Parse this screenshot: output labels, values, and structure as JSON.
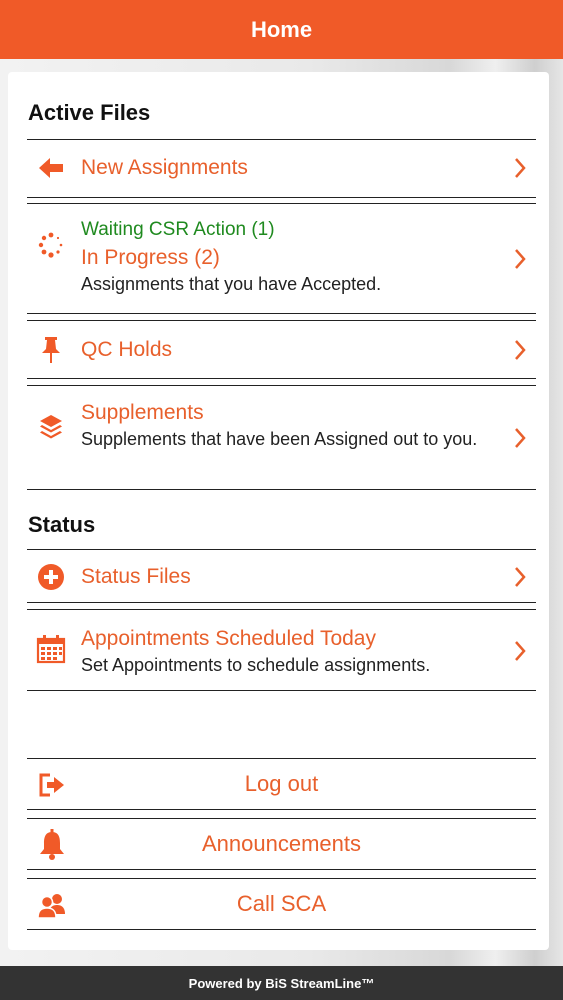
{
  "header": {
    "title": "Home"
  },
  "colors": {
    "accent": "#f05a28",
    "link": "#e8602c",
    "green": "#1f8a1f",
    "footer": "#333333"
  },
  "active_files": {
    "title": "Active Files",
    "items": [
      {
        "icon": "arrow-left-icon",
        "label": "New Assignments"
      },
      {
        "icon": "spinner-icon",
        "status": "Waiting CSR Action (1)",
        "label": "In Progress (2)",
        "description": "Assignments that you have Accepted."
      },
      {
        "icon": "pushpin-icon",
        "label": "QC Holds"
      },
      {
        "icon": "layers-icon",
        "label": "Supplements",
        "description": "Supplements that have been Assigned out to you."
      }
    ]
  },
  "status": {
    "title": "Status",
    "items": [
      {
        "icon": "plus-circle-icon",
        "label": "Status Files"
      },
      {
        "icon": "calendar-icon",
        "label": "Appointments Scheduled Today",
        "description": "Set Appointments to schedule assignments."
      }
    ]
  },
  "actions": [
    {
      "icon": "logout-icon",
      "label": "Log out"
    },
    {
      "icon": "bell-icon",
      "label": "Announcements"
    },
    {
      "icon": "users-icon",
      "label": "Call SCA"
    }
  ],
  "footer": {
    "text": "Powered by BiS StreamLine™"
  }
}
